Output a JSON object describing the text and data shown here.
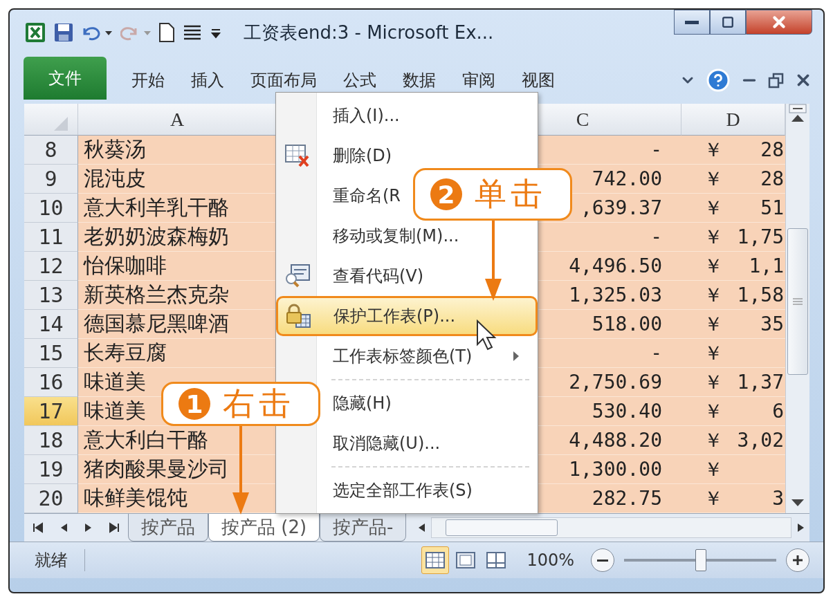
{
  "window": {
    "title": "工资表end:3  -  Microsoft Ex..."
  },
  "ribbon": {
    "tabs": [
      {
        "label": "文件",
        "kind": "file"
      },
      {
        "label": "开始",
        "kind": "tab"
      },
      {
        "label": "插入",
        "kind": "tab"
      },
      {
        "label": "页面布局",
        "kind": "tab"
      },
      {
        "label": "公式",
        "kind": "tab"
      },
      {
        "label": "数据",
        "kind": "tab"
      },
      {
        "label": "审阅",
        "kind": "tab"
      },
      {
        "label": "视图",
        "kind": "tab"
      }
    ]
  },
  "sheet": {
    "columns": [
      {
        "label": "A"
      },
      {
        "label": "C"
      },
      {
        "label": "D"
      }
    ],
    "rows": [
      {
        "number": "8",
        "selected": false,
        "a": "秋葵汤",
        "c": "-",
        "d_symbol": "￥",
        "d": "28"
      },
      {
        "number": "9",
        "selected": false,
        "a": "混沌皮",
        "c": "742.00",
        "d_symbol": "￥",
        "d": "28"
      },
      {
        "number": "10",
        "selected": false,
        "a": "意大利羊乳干酪",
        "c": ",639.37",
        "d_symbol": "￥",
        "d": "51"
      },
      {
        "number": "11",
        "selected": false,
        "a": "老奶奶波森梅奶",
        "c": "-",
        "d_symbol": "￥",
        "d": "1,75"
      },
      {
        "number": "12",
        "selected": false,
        "a": "怡保咖啡",
        "c": "4,496.50",
        "d_symbol": "￥",
        "d": "1,1"
      },
      {
        "number": "13",
        "selected": false,
        "a": "新英格兰杰克杂",
        "c": "1,325.03",
        "d_symbol": "￥",
        "d": "1,58"
      },
      {
        "number": "14",
        "selected": false,
        "a": "德国慕尼黑啤酒",
        "c": "518.00",
        "d_symbol": "￥",
        "d": "35"
      },
      {
        "number": "15",
        "selected": false,
        "a": "长寿豆腐",
        "c": "-",
        "d_symbol": "￥"
      },
      {
        "number": "16",
        "selected": false,
        "a": "味道美",
        "c": "2,750.69",
        "d_symbol": "￥",
        "d": "1,37"
      },
      {
        "number": "17",
        "selected": true,
        "a": "味道美",
        "c": "530.40",
        "d_symbol": "￥",
        "d": "6"
      },
      {
        "number": "18",
        "selected": false,
        "a": "意大利白干酪",
        "c": "4,488.20",
        "d_symbol": "￥",
        "d": "3,02"
      },
      {
        "number": "19",
        "selected": false,
        "a": "猪肉酸果曼沙司",
        "c": "1,300.00",
        "d_symbol": "￥"
      },
      {
        "number": "20",
        "selected": false,
        "a": "味鲜美馄饨",
        "c": "282.75",
        "d_symbol": "￥",
        "d": "3"
      }
    ]
  },
  "sheet_tabs": [
    {
      "label": "按产品",
      "selected": false
    },
    {
      "label": "按产品 (2)",
      "selected": true
    },
    {
      "label": "按产品-",
      "selected": false
    }
  ],
  "status": {
    "text": "就绪",
    "views": [
      {
        "kind": "normal",
        "selected": true
      },
      {
        "kind": "page_layout",
        "selected": false
      },
      {
        "kind": "page_break",
        "selected": false
      }
    ],
    "zoom": "100%",
    "zoom_slider": {
      "level": 0.5
    }
  },
  "menu": {
    "items": [
      {
        "kind": "item",
        "label": "插入(I)...",
        "selected": false
      },
      {
        "kind": "delete",
        "label": "删除(D)",
        "selected": false
      },
      {
        "kind": "item",
        "label": "重命名(R",
        "selected": false
      },
      {
        "kind": "item",
        "label": "移动或复制(M)...",
        "selected": false
      },
      {
        "kind": "code",
        "label": "查看代码(V)",
        "selected": false
      },
      {
        "kind": "protect",
        "label": "保护工作表(P)...",
        "selected": true
      },
      {
        "kind": "submenu",
        "label": "工作表标签颜色(T)",
        "selected": false
      },
      {
        "kind": "separator"
      },
      {
        "kind": "item",
        "label": "隐藏(H)",
        "selected": false
      },
      {
        "kind": "item",
        "label": "取消隐藏(U)...",
        "selected": false
      },
      {
        "kind": "separator"
      },
      {
        "kind": "item",
        "label": "选定全部工作表(S)",
        "selected": false
      }
    ]
  },
  "callouts": [
    {
      "number": "1",
      "label": "右击"
    },
    {
      "number": "2",
      "label": "单击"
    }
  ]
}
